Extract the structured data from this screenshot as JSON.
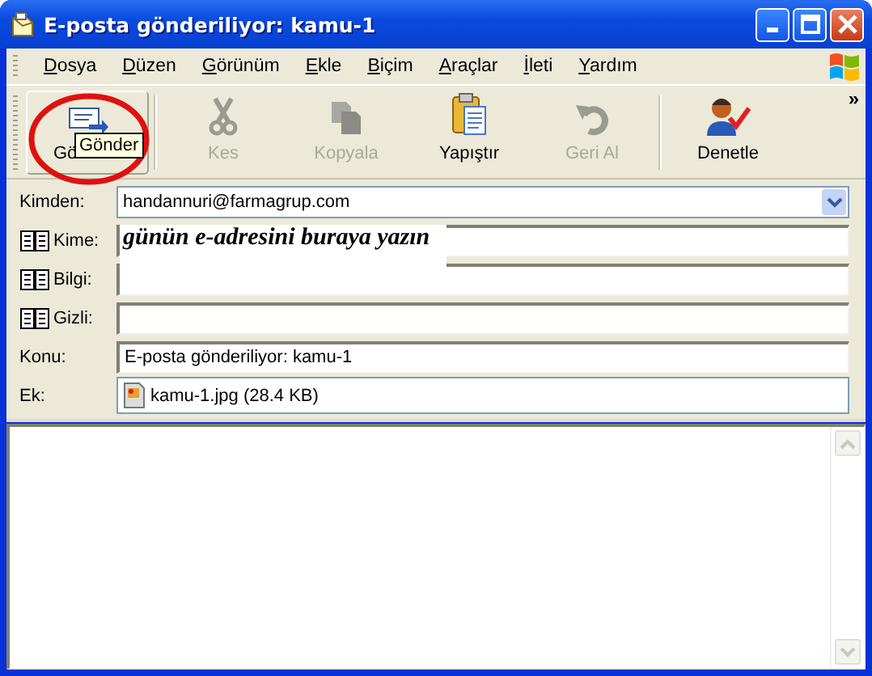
{
  "window": {
    "title": "E-posta gönderiliyor: kamu-1"
  },
  "menu": [
    "Dosya",
    "Düzen",
    "Görünüm",
    "Ekle",
    "Biçim",
    "Araçlar",
    "İleti",
    "Yardım"
  ],
  "toolbar": [
    {
      "label": "Gö",
      "disabled": false,
      "hovered": true,
      "group_end": true
    },
    {
      "label": "Kes",
      "disabled": true,
      "hovered": false,
      "group_end": false
    },
    {
      "label": "Kopyala",
      "disabled": true,
      "hovered": false,
      "group_end": false
    },
    {
      "label": "Yapıştır",
      "disabled": false,
      "hovered": false,
      "group_end": false
    },
    {
      "label": "Geri Al",
      "disabled": true,
      "hovered": false,
      "group_end": true
    },
    {
      "label": "Denetle",
      "disabled": false,
      "hovered": false,
      "group_end": false
    }
  ],
  "tooltip": "Gönder",
  "overflow": "»",
  "fields": [
    {
      "kind": "dropdown",
      "label": "Kimden:",
      "value": "handannuri@farmagrup.com"
    },
    {
      "kind": "address",
      "label": "Kime:",
      "note": "günün e-adresini buraya yazın"
    },
    {
      "kind": "address",
      "label": "Bilgi:"
    },
    {
      "kind": "address",
      "label": "Gizli:"
    },
    {
      "kind": "text",
      "label": "Konu:",
      "value": "E-posta gönderiliyor: kamu-1"
    },
    {
      "kind": "attachment",
      "label": "Ek:",
      "value": "kamu-1.jpg (28.4 KB)"
    }
  ]
}
